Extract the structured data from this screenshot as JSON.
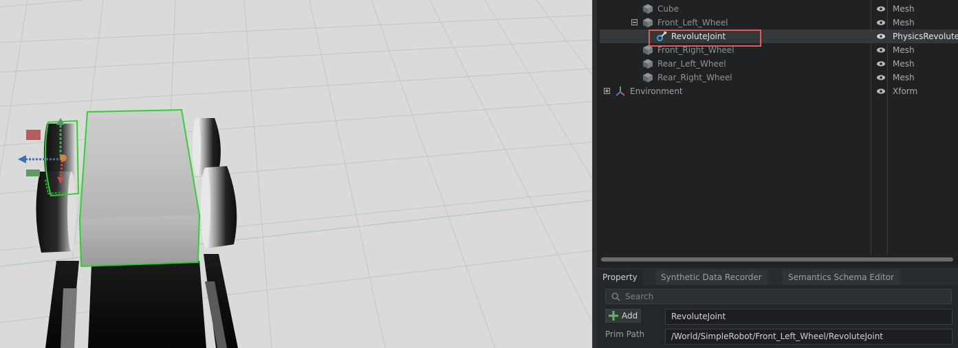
{
  "stage": {
    "rows": [
      {
        "name": "Cube",
        "type": "Mesh",
        "icon": "cube-icon"
      },
      {
        "name": "Front_Left_Wheel",
        "type": "Mesh",
        "icon": "cube-icon",
        "expander": "collapse"
      },
      {
        "name": "RevoluteJoint",
        "type": "PhysicsRevolute",
        "icon": "revolute-joint-icon",
        "selected": true
      },
      {
        "name": "Front_Right_Wheel",
        "type": "Mesh",
        "icon": "cube-icon"
      },
      {
        "name": "Rear_Left_Wheel",
        "type": "Mesh",
        "icon": "cube-icon"
      },
      {
        "name": "Rear_Right_Wheel",
        "type": "Mesh",
        "icon": "cube-icon"
      },
      {
        "name": "Environment",
        "type": "Xform",
        "icon": "xform-icon",
        "expander": "expand"
      }
    ]
  },
  "property_panel": {
    "tabs": [
      "Property",
      "Synthetic Data Recorder",
      "Semantics Schema Editor"
    ],
    "active_tab": "Property",
    "search_placeholder": "Search",
    "add_label": "Add",
    "name_value": "RevoluteJoint",
    "prim_path_label": "Prim Path",
    "prim_path_value": "/World/SimpleRobot/Front_Left_Wheel/RevoluteJoint"
  },
  "colors": {
    "selection_outline": "#2fd12f",
    "highlight_box": "#e35b55",
    "selected_row": "#34383b"
  }
}
